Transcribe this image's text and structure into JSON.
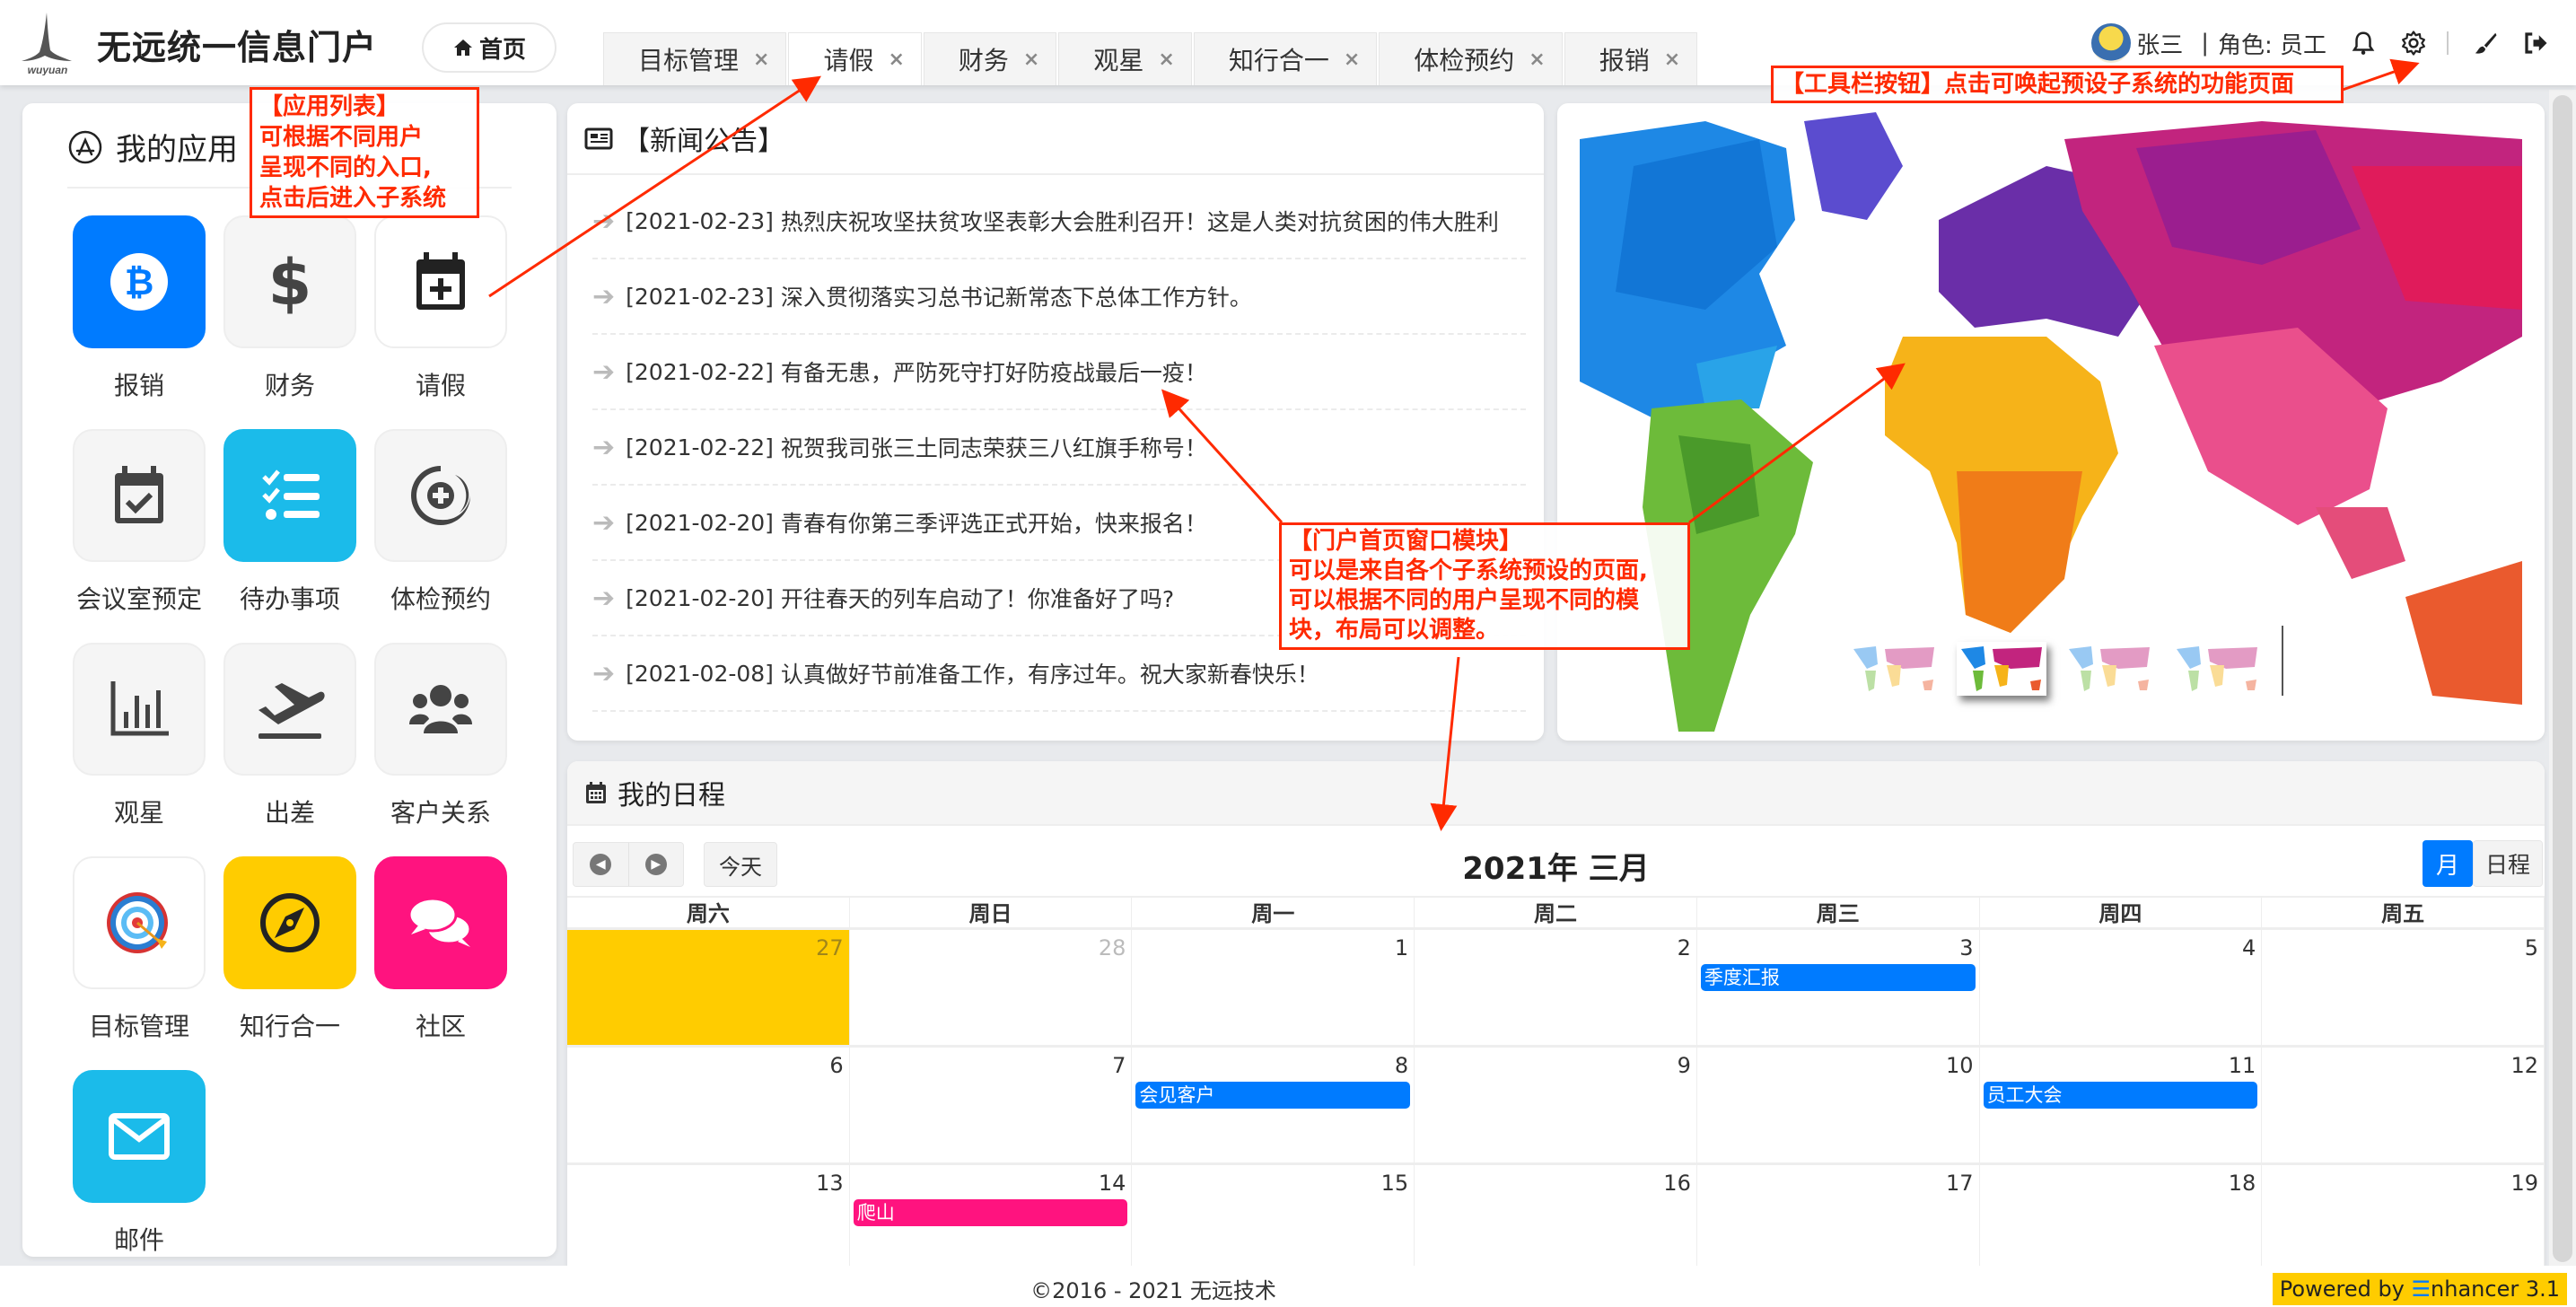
{
  "header": {
    "logo_text": "wuyuan",
    "title": "无远统一信息门户",
    "home_label": "首页",
    "tabs": [
      {
        "label": "目标管理",
        "close": "×"
      },
      {
        "label": "请假",
        "close": "×"
      },
      {
        "label": "财务",
        "close": "×"
      },
      {
        "label": "观星",
        "close": "×"
      },
      {
        "label": "知行合一",
        "close": "×"
      },
      {
        "label": "体检预约",
        "close": "×"
      },
      {
        "label": "报销",
        "close": "×"
      }
    ],
    "active_tab": "请假",
    "user": {
      "name": "张三",
      "separator": "|",
      "role": "角色: 员工"
    },
    "toolbar_icons": [
      "bell-icon",
      "gear-icon",
      "brush-icon",
      "logout-icon"
    ]
  },
  "apps": {
    "title": "我的应用",
    "items": [
      {
        "label": "报销",
        "icon": "bitcoin-icon",
        "bg": "#007bff"
      },
      {
        "label": "财务",
        "icon": "dollar-icon",
        "bg": "#f5f5f5"
      },
      {
        "label": "请假",
        "icon": "calendar-plus-icon",
        "bg": "#ffffff"
      },
      {
        "label": "会议室预定",
        "icon": "calendar-check-icon",
        "bg": "#f5f5f5"
      },
      {
        "label": "待办事项",
        "icon": "tasks-icon",
        "bg": "#1bbbea"
      },
      {
        "label": "体检预约",
        "icon": "medical-icon",
        "bg": "#f5f5f5"
      },
      {
        "label": "观星",
        "icon": "bar-chart-icon",
        "bg": "#f5f5f5"
      },
      {
        "label": "出差",
        "icon": "plane-departure-icon",
        "bg": "#f5f5f5"
      },
      {
        "label": "客户关系",
        "icon": "users-icon",
        "bg": "#f5f5f5"
      },
      {
        "label": "目标管理",
        "icon": "target-icon",
        "bg": "#ffffff"
      },
      {
        "label": "知行合一",
        "icon": "compass-icon",
        "bg": "#ffcc00"
      },
      {
        "label": "社区",
        "icon": "comments-icon",
        "bg": "#ff137f"
      },
      {
        "label": "邮件",
        "icon": "envelope-icon",
        "bg": "#1bbbea"
      }
    ]
  },
  "news": {
    "title": "【新闻公告】",
    "items": [
      {
        "date": "[2021-02-23]",
        "text": "热烈庆祝攻坚扶贫攻坚表彰大会胜利召开！这是人类对抗贫困的伟大胜利"
      },
      {
        "date": "[2021-02-23]",
        "text": "深入贯彻落实习总书记新常态下总体工作方针。"
      },
      {
        "date": "[2021-02-22]",
        "text": "有备无患，严防死守打好防疫战最后一疫！"
      },
      {
        "date": "[2021-02-22]",
        "text": "祝贺我司张三土同志荣获三八红旗手称号！"
      },
      {
        "date": "[2021-02-20]",
        "text": "青春有你第三季评选正式开始，快来报名！"
      },
      {
        "date": "[2021-02-20]",
        "text": "开往春天的列车启动了！你准备好了吗?"
      },
      {
        "date": "[2021-02-08]",
        "text": "认真做好节前准备工作，有序过年。祝大家新春快乐！"
      }
    ]
  },
  "carousel": {
    "slide_count": 4,
    "active_slide": 2
  },
  "calendar": {
    "title": "我的日程",
    "month_title": "2021年 三月",
    "today_label": "今天",
    "prev_icon": "chevron-left-icon",
    "next_icon": "chevron-right-icon",
    "view_month": "月",
    "view_list": "日程",
    "weekdays": [
      "周六",
      "周日",
      "周一",
      "周二",
      "周三",
      "周四",
      "周五"
    ],
    "weeks": [
      [
        {
          "d": "27",
          "other": true,
          "today": true
        },
        {
          "d": "28",
          "other": true
        },
        {
          "d": "1"
        },
        {
          "d": "2"
        },
        {
          "d": "3",
          "event": "季度汇报",
          "color": "#007bff"
        },
        {
          "d": "4"
        },
        {
          "d": "5"
        }
      ],
      [
        {
          "d": "6"
        },
        {
          "d": "7"
        },
        {
          "d": "8",
          "event": "会见客户",
          "color": "#007bff"
        },
        {
          "d": "9"
        },
        {
          "d": "10"
        },
        {
          "d": "11",
          "event": "员工大会",
          "color": "#007bff"
        },
        {
          "d": "12"
        }
      ],
      [
        {
          "d": "13"
        },
        {
          "d": "14",
          "event": "爬山",
          "color": "#ff137f"
        },
        {
          "d": "15"
        },
        {
          "d": "16"
        },
        {
          "d": "17"
        },
        {
          "d": "18"
        },
        {
          "d": "19"
        }
      ]
    ]
  },
  "footer": {
    "copyright": "©2016 - 2021 无远技术",
    "powered_prefix": "Powered by ",
    "powered_mark": "☰",
    "powered_suffix": "nhancer 3.1"
  },
  "annotations": {
    "app_list": "【应用列表】\n可根据不同用户\n呈现不同的入口,\n点击后进入子系统",
    "toolbar": "【工具栏按钮】点击可唤起预设子系统的功能页面",
    "portal": "【门户首页窗口模块】\n可以是来自各个子系统预设的页面,\n可以根据不同的用户呈现不同的模\n块，布局可以调整。"
  },
  "colors": {
    "accent": "#007bff",
    "annotation": "#ff2a00",
    "today": "#ffcc00",
    "pink": "#ff137f"
  }
}
